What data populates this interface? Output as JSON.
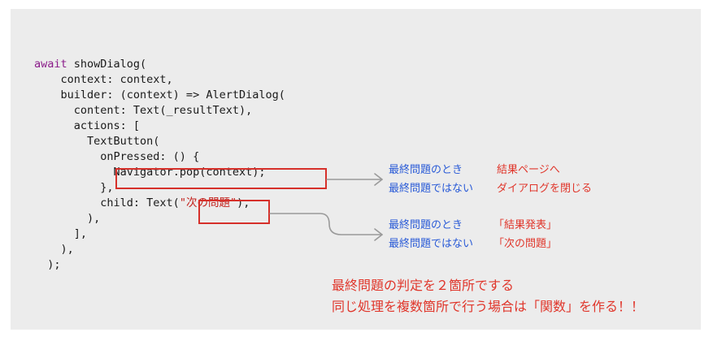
{
  "code": {
    "keyword": "await",
    "line1_rest": " showDialog(",
    "line2": "    context: context,",
    "line3": "    builder: (context) => AlertDialog(",
    "line4": "      content: Text(_resultText),",
    "line5": "      actions: [",
    "line6": "        TextButton(",
    "line7": "          onPressed: () {",
    "line8_indent": "            ",
    "line8_highlight": "Navigator.pop(context);",
    "line9": "          },",
    "line10_prefix": "          child: Text(",
    "line10_highlight": "\"次の問題\"",
    "line10_suffix": "),",
    "line11": "        ),",
    "line12": "      ],",
    "line13": "    ),",
    "line14": "  );"
  },
  "annotations": [
    {
      "rows": [
        {
          "condition": "最終問題のとき",
          "result": "結果ページへ"
        },
        {
          "condition": "最終問題ではない",
          "result": "ダイアログを閉じる"
        }
      ]
    },
    {
      "rows": [
        {
          "condition": "最終問題のとき",
          "result": "「結果発表」"
        },
        {
          "condition": "最終問題ではない",
          "result": "「次の問題」"
        }
      ]
    }
  ],
  "summary": {
    "line1": "最終問題の判定を２箇所でする",
    "line2": "同じ処理を複数箇所で行う場合は「関数」を作る！！"
  },
  "colors": {
    "panel_bg": "#ececec",
    "keyword": "#8b1d8a",
    "highlight_border": "#d6302a",
    "condition_text": "#2a5bd7",
    "result_text": "#e0362b",
    "arrow": "#9a9a9a"
  }
}
